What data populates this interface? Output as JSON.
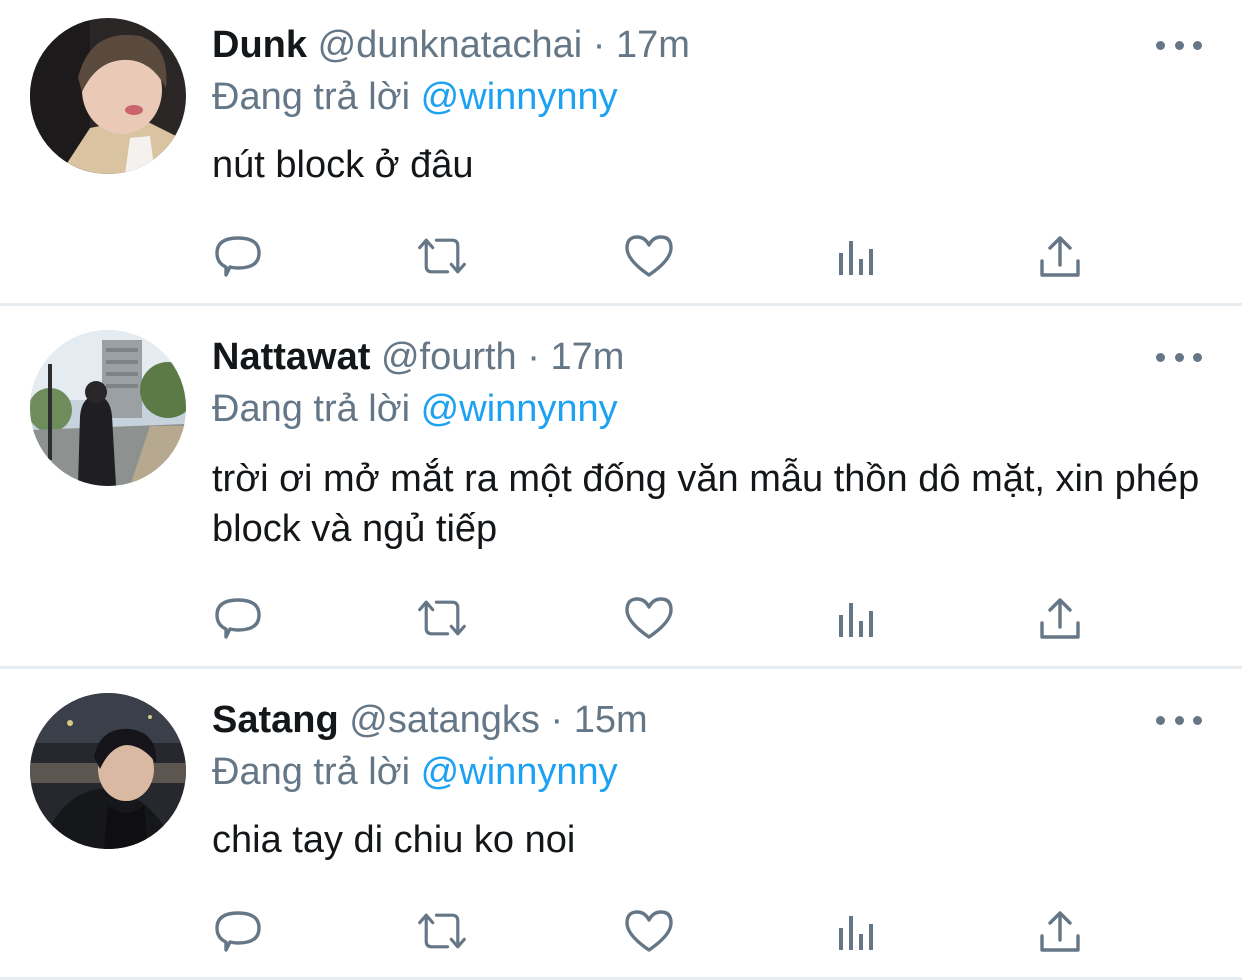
{
  "colors": {
    "text": "#14171a",
    "secondary": "#657786",
    "mention": "#1da1f2",
    "divider": "#e6ecf0"
  },
  "icons": {
    "reply": "reply-icon",
    "retweet": "retweet-icon",
    "like": "like-icon",
    "stats": "stats-icon",
    "share": "share-icon",
    "more": "more-icon"
  },
  "tweets": [
    {
      "name": "Dunk",
      "handle": "@dunknatachai",
      "separator": "·",
      "time": "17m",
      "reply_prefix": "Đang trả lời",
      "reply_to": "@winnynny",
      "text": "nút block ở đâu"
    },
    {
      "name": "Nattawat",
      "handle": "@fourth",
      "separator": "·",
      "time": "17m",
      "reply_prefix": "Đang trả lời",
      "reply_to": "@winnynny",
      "text": "trời ơi mở mắt ra một đống văn mẫu thồn dô mặt, xin phép block và ngủ tiếp"
    },
    {
      "name": "Satang",
      "handle": "@satangks",
      "separator": "·",
      "time": "15m",
      "reply_prefix": "Đang trả lời",
      "reply_to": "@winnynny",
      "text": "chia tay di chiu ko noi"
    }
  ]
}
